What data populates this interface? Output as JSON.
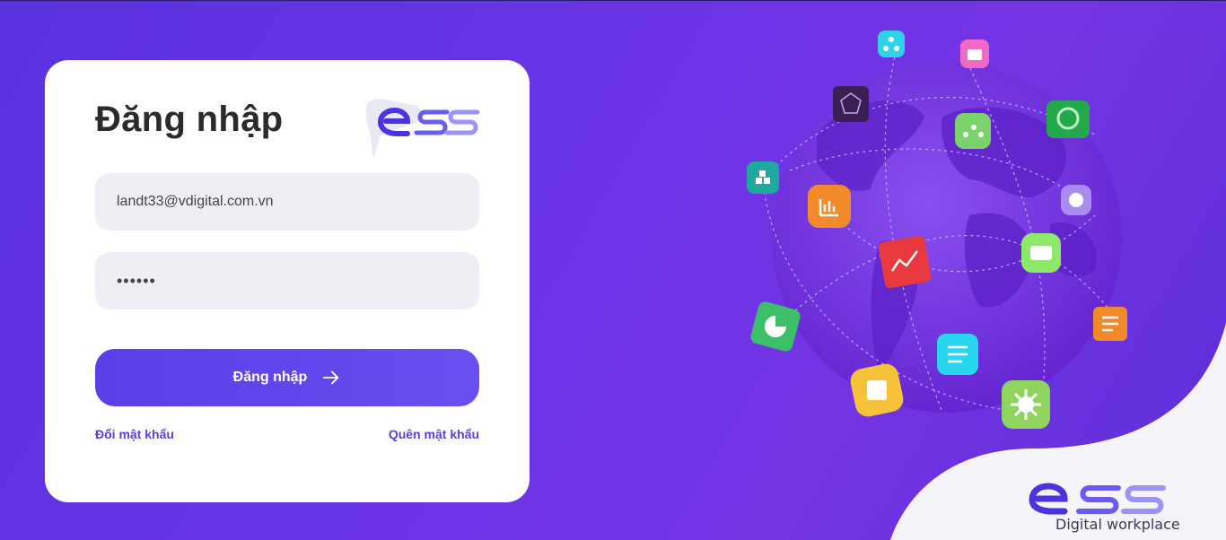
{
  "login": {
    "title": "Đăng nhập",
    "logo_alt": "ess",
    "email_value": "landt33@vdigital.com.vn",
    "password_value": "••••••",
    "submit_label": "Đăng nhập",
    "change_password_label": "Đổi mật khẩu",
    "forgot_password_label": "Quên mật khẩu"
  },
  "brand": {
    "logo": "ess",
    "tagline": "Digital workplace",
    "accent": "#5b3ee6",
    "background_start": "#5a32e0",
    "background_end": "#7434e4"
  },
  "illustration": {
    "name": "globe-with-app-icons",
    "icons": [
      "org-chart-icon",
      "briefcase-icon",
      "cube-chart-icon",
      "report-icon",
      "share-icon",
      "blocks-icon",
      "bar-chart-icon",
      "clock-icon",
      "analytics-icon",
      "card-icon",
      "pie-chart-icon",
      "checklist-icon",
      "calendar-icon",
      "gear-icon",
      "document-icon"
    ]
  }
}
